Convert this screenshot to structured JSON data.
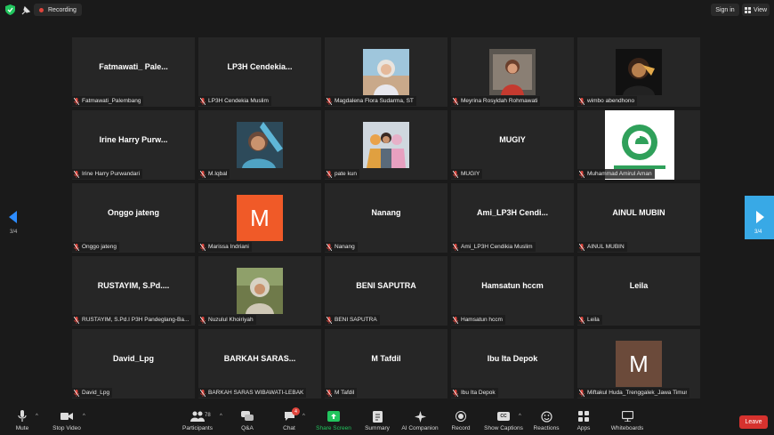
{
  "topbar": {
    "recording_label": "Recording",
    "signin_label": "Sign in",
    "view_label": "View"
  },
  "tiles": [
    {
      "display": "Fatmawati_ Pale...",
      "label": "Fatmawati_Palembang",
      "type": "name"
    },
    {
      "display": "LP3H Cendekia...",
      "label": "LP3H Cendekia Muslim",
      "type": "name"
    },
    {
      "display": "",
      "label": "Magdalena Flora Sudarma, ST",
      "type": "photo"
    },
    {
      "display": "",
      "label": "Meyrina Rosyidah Rohmawati",
      "type": "photo"
    },
    {
      "display": "",
      "label": "wimbo abendhono",
      "type": "photo"
    },
    {
      "display": "Irine Harry Purw...",
      "label": "Irine Harry Purwandari",
      "type": "name"
    },
    {
      "display": "",
      "label": "M.Iqbal",
      "type": "photo"
    },
    {
      "display": "",
      "label": "pate kun",
      "type": "photo"
    },
    {
      "display": "MUGIY",
      "label": "MUGIY",
      "type": "name"
    },
    {
      "display": "",
      "label": "Muhammad Amirul Aman",
      "type": "logo"
    },
    {
      "display": "Onggo jateng",
      "label": "Onggo jateng",
      "type": "name"
    },
    {
      "display": "M",
      "label": "Marissa Indriani",
      "type": "letter",
      "color": "#f05a28"
    },
    {
      "display": "Nanang",
      "label": "Nanang",
      "type": "name"
    },
    {
      "display": "Ami_LP3H Cendi...",
      "label": "Ami_LP3H Cendikia Muslim",
      "type": "name"
    },
    {
      "display": "AINUL MUBIN",
      "label": "AINUL MUBIN",
      "type": "name"
    },
    {
      "display": "RUSTAYIM, S.Pd....",
      "label": "RUSTAYIM, S.Pd.I P3H Pandeglang-Ba...",
      "type": "name"
    },
    {
      "display": "",
      "label": "Nuzulul Khoiriyah",
      "type": "photo"
    },
    {
      "display": "BENI SAPUTRA",
      "label": "BENI SAPUTRA",
      "type": "name"
    },
    {
      "display": "Hamsatun hccm",
      "label": "Hamsatun hccm",
      "type": "name"
    },
    {
      "display": "Leila",
      "label": "Leila",
      "type": "name"
    },
    {
      "display": "David_Lpg",
      "label": "David_Lpg",
      "type": "name"
    },
    {
      "display": "BARKAH SARAS...",
      "label": "BARKAH SARAS WIBAWATI-LEBAK",
      "type": "name"
    },
    {
      "display": "M Tafdil",
      "label": "M Tafdil",
      "type": "name"
    },
    {
      "display": "Ibu Ita Depok",
      "label": "Ibu Ita Depok",
      "type": "name"
    },
    {
      "display": "M",
      "label": "Miftakul Huda_Trenggalek_Jawa Timur",
      "type": "letter",
      "color": "#6b4a3a"
    }
  ],
  "pager": {
    "left": "3/4",
    "right": "3/4"
  },
  "toolbar": {
    "mute": "Mute",
    "stop_video": "Stop Video",
    "participants": "Participants",
    "participants_count": "78",
    "qa": "Q&A",
    "chat": "Chat",
    "chat_badge": "4",
    "share_screen": "Share Screen",
    "summary": "Summary",
    "ai_companion": "AI Companion",
    "record": "Record",
    "show_captions": "Show Captions",
    "captions_badge": "CC",
    "reactions": "Reactions",
    "apps": "Apps",
    "whiteboards": "Whiteboards",
    "leave": "Leave"
  },
  "colors": {
    "accent": "#2d8cff",
    "share_green": "#22c55e",
    "muted_red": "#e0453c",
    "leave_red": "#d6322e"
  }
}
